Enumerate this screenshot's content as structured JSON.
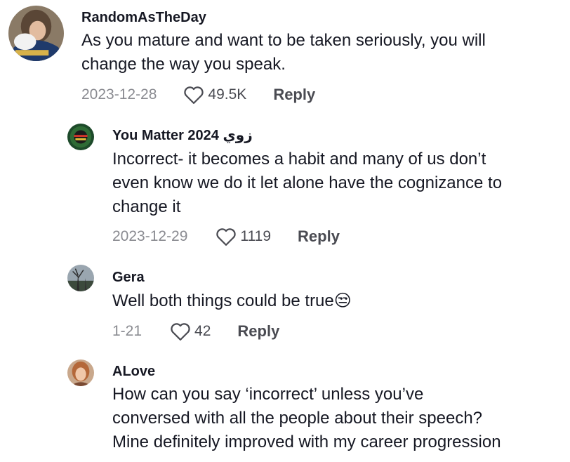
{
  "comments": [
    {
      "username": "RandomAsTheDay",
      "lines": [
        "As you mature and want to be taken seriously, you will",
        "change the way you speak."
      ],
      "date": "2023-12-28",
      "likes": "49.5K",
      "reply_label": "Reply"
    },
    {
      "username": "You Matter 2024 زوي",
      "lines": [
        "Incorrect- it becomes a habit and many of us don’t",
        "even know we do it let alone have the cognizance to",
        "change it"
      ],
      "date": "2023-12-29",
      "likes": "1119",
      "reply_label": "Reply"
    },
    {
      "username": "Gera",
      "lines": [
        "Well both things could be true😒"
      ],
      "date": "1-21",
      "likes": "42",
      "reply_label": "Reply"
    },
    {
      "username": "ALove",
      "lines": [
        "How can you say ‘incorrect’ unless you’ve",
        "conversed with all the people about their speech?",
        "Mine definitely improved with my career progression"
      ]
    }
  ],
  "icons": {
    "like": "heart-outline-icon"
  },
  "colors": {
    "text": "#161823",
    "muted": "#8a8b91",
    "reply": "#4a4b52"
  }
}
